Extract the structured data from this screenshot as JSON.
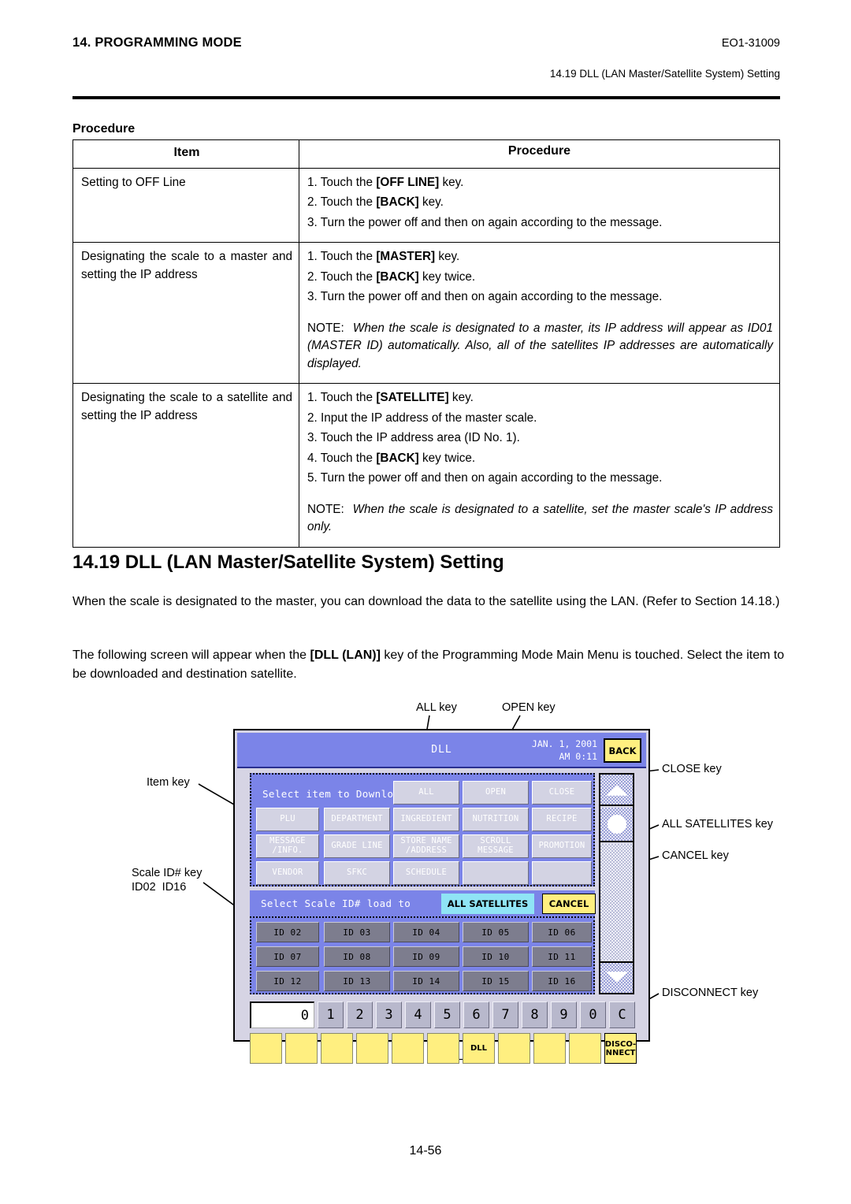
{
  "header": {
    "chapter": "14. PROGRAMMING MODE",
    "doc_code": "EO1-31009",
    "section_ref": "14.19 DLL (LAN Master/Satellite System) Setting"
  },
  "procedure": {
    "label": "Procedure",
    "columns": [
      "Item",
      "Procedure"
    ],
    "rows": [
      {
        "item": "Setting to OFF Line",
        "steps": [
          "1. Touch the [OFF LINE] key.",
          "2. Touch the [BACK] key.",
          "3. Turn the power off and then on again according to the message."
        ],
        "note": ""
      },
      {
        "item": "Designating the scale to a master and setting the IP address",
        "steps": [
          "1. Touch the [MASTER] key.",
          "2. Touch the [BACK] key twice.",
          "3. Turn the power off and then on again according to the message."
        ],
        "note_label": "NOTE:",
        "note": "When the scale is designated to a master, its IP address will appear as ID01 (MASTER ID) automatically.  Also, all of the satellites IP addresses are automatically displayed."
      },
      {
        "item": "Designating the scale to a satellite and setting the IP address",
        "steps": [
          "1. Touch the [SATELLITE] key.",
          "2. Input the IP address of the master scale.",
          "3. Touch the IP address area (ID No. 1).",
          "4. Touch the [BACK] key twice.",
          "5. Turn the power off and then on again according to the message."
        ],
        "note_label": "NOTE:",
        "note": "When the scale is designated to a satellite, set the master scale's IP address only."
      }
    ]
  },
  "section": {
    "heading": "14.19  DLL (LAN Master/Satellite System) Setting",
    "para1": "When the scale is designated to the master, you can download the data to the satellite using the LAN. (Refer to Section 14.18.)",
    "para2_pre": "The following screen will appear when the ",
    "para2_bold": "[DLL (LAN)]",
    "para2_post": " key of the Programming Mode Main Menu is touched.  Select the item to be downloaded and destination satellite."
  },
  "callouts": {
    "all_key": "ALL key",
    "open_key": "OPEN key",
    "close_key": "CLOSE key",
    "all_satellites_key": "ALL SATELLITES key",
    "cancel_key": "CANCEL key",
    "disconnect_key": "DISCONNECT key",
    "item_key": "Item key",
    "scale_id_key_line1": "Scale ID# key",
    "scale_id_key_line2": "ID02  ID16",
    "dll_key": "DLL key"
  },
  "device": {
    "title": "DLL",
    "date": "JAN. 1, 2001",
    "time": "AM 0:11",
    "back_label": "BACK",
    "item_prompt": "Select item to Download",
    "top_keys": [
      "ALL",
      "OPEN",
      "CLOSE"
    ],
    "item_keys": [
      "PLU",
      "DEPARTMENT",
      "INGREDIENT",
      "NUTRITION",
      "RECIPE",
      "MESSAGE\n/INFO.",
      "GRADE LINE",
      "STORE NAME\n/ADDRESS",
      "SCROLL\nMESSAGE",
      "PROMOTION",
      "VENDOR",
      "SFKC",
      "SCHEDULE",
      "",
      ""
    ],
    "sat_prompt": "Select Scale ID# load to",
    "all_satellites_label": "ALL SATELLITES",
    "cancel_label": "CANCEL",
    "id_keys": [
      "ID 02",
      "ID 03",
      "ID 04",
      "ID 05",
      "ID 06",
      "ID 07",
      "ID 08",
      "ID 09",
      "ID 10",
      "ID 11",
      "ID 12",
      "ID 13",
      "ID 14",
      "ID 15",
      "ID 16"
    ],
    "numeric_display": "0",
    "numeric_keys": [
      "1",
      "2",
      "3",
      "4",
      "5",
      "6",
      "7",
      "8",
      "9",
      "0",
      "C"
    ],
    "function_keys": [
      "",
      "",
      "",
      "",
      "",
      "",
      "DLL",
      "",
      "",
      "",
      "DISCO-\nNNECT"
    ],
    "colors": {
      "panel_blue": "#7b84e8",
      "key_grey": "#d3d3e3",
      "id_key_grey": "#7d7d8e",
      "yellow": "#ffef80",
      "cyan": "#8fe4f5",
      "bezel": "#d6d4e4"
    }
  },
  "footer": {
    "page_number": "14-56"
  }
}
